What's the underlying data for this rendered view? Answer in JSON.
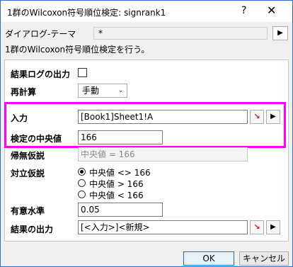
{
  "window": {
    "title": "1群のWilcoxon符号順位検定: signrank1",
    "help_label": "?",
    "close_label": "✕"
  },
  "theme": {
    "label": "ダイアログ-テーマ",
    "value": "*",
    "arrow": "▶"
  },
  "description": "1群のWilcoxon符号順位検定を行う。",
  "form": {
    "log_output": {
      "label": "結果ログの出力",
      "checked": false
    },
    "recalc": {
      "label": "再計算",
      "value": "手動",
      "chevron": "⌄"
    },
    "input": {
      "label": "入力",
      "value": "[Book1]Sheet1!A"
    },
    "median": {
      "label": "検定の中央値",
      "value": "166"
    },
    "null_hypothesis": {
      "label": "帰無仮説",
      "value": "中央値 = 166"
    },
    "alternative": {
      "label": "対立仮説",
      "options": [
        {
          "label": "中央値 <> 166",
          "selected": true
        },
        {
          "label": "中央値 > 166",
          "selected": false
        },
        {
          "label": "中央値 < 166",
          "selected": false
        }
      ]
    },
    "significance": {
      "label": "有意水準",
      "value": "0.05"
    },
    "output": {
      "label": "結果の出力",
      "value": "[<入力>]<新規>"
    }
  },
  "buttons": {
    "ok": "OK",
    "cancel": "キャンセル"
  },
  "icons": {
    "picker": "↘",
    "arrow": "▶"
  }
}
